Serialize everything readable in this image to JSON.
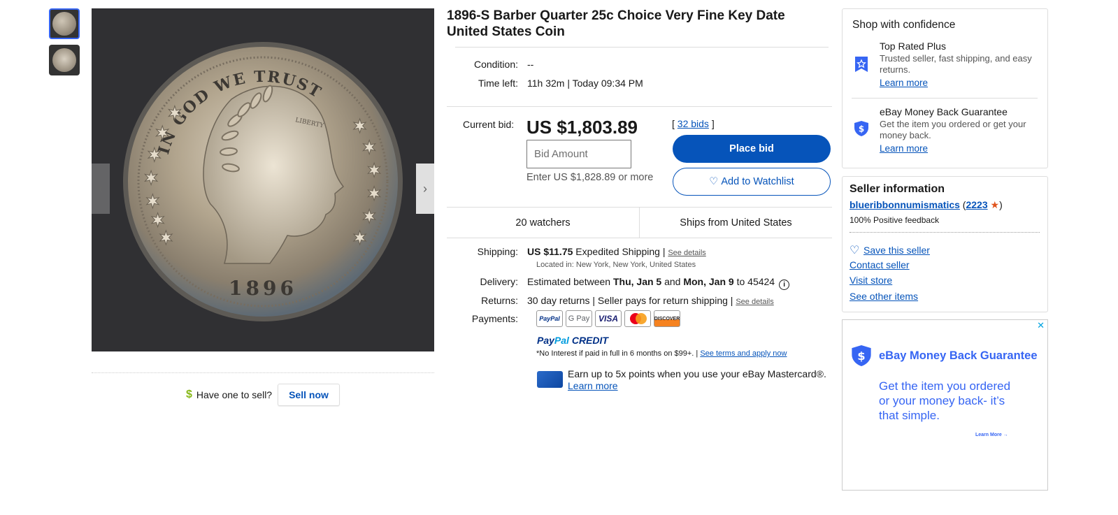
{
  "colors": {
    "brand_blue": "#0654ba",
    "accent_blue": "#3665f3",
    "text": "#191919",
    "muted": "#555555",
    "star": "#e0531c",
    "dollar_green": "#86b817"
  },
  "listing": {
    "title": "1896-S Barber Quarter 25c Choice Very Fine Key Date United States Coin",
    "condition_label": "Condition:",
    "condition_value": "--",
    "time_left_label": "Time left:",
    "time_left_value": "11h 32m | Today 09:34 PM",
    "current_bid_label": "Current bid:",
    "current_bid_value": "US $1,803.89",
    "bid_input_placeholder": "Bid Amount",
    "bid_hint": "Enter US $1,828.89 or more",
    "bids_open": "[ ",
    "bids_link": "32 bids",
    "bids_close": " ]",
    "place_bid": "Place bid",
    "watchlist": "Add to Watchlist",
    "watchers": "20 watchers",
    "ships_from": "Ships from United States"
  },
  "image": {
    "coin_inscription": "IN GOD WE TRUST",
    "coin_year": "1896",
    "coin_liberty": "LIBERTY"
  },
  "sell": {
    "prompt": "Have one to sell?",
    "button": "Sell now"
  },
  "shipping": {
    "label": "Shipping:",
    "price": "US $11.75",
    "method": " Expedited Shipping | ",
    "see_details": "See details",
    "location": "Located in: New York, New York, United States"
  },
  "delivery": {
    "label": "Delivery:",
    "text_a": "Estimated between ",
    "date_a": "Thu, Jan 5",
    "text_b": " and ",
    "date_b": "Mon, Jan 9",
    "text_c": " to 45424",
    "info_icon": "i"
  },
  "returns": {
    "label": "Returns:",
    "text": "30 day returns | Seller pays for return shipping | ",
    "see_details": "See details"
  },
  "payments": {
    "label": "Payments:",
    "methods": [
      "PayPal",
      "G Pay",
      "VISA",
      "Mastercard",
      "DISCOVER"
    ],
    "paypal_credit_a": "Pay",
    "paypal_credit_b": "Pal",
    "paypal_credit_c": " CREDIT",
    "note": "*No Interest if paid in full in 6 months on $99+. | ",
    "note_link": "See terms and apply now",
    "mastercard_text": "Earn up to 5x points when you use your eBay Mastercard®.",
    "mastercard_link": "Learn more"
  },
  "confidence": {
    "title": "Shop with confidence",
    "items": [
      {
        "heading": "Top Rated Plus",
        "text": "Trusted seller, fast shipping, and easy returns.",
        "link": "Learn more"
      },
      {
        "heading": "eBay Money Back Guarantee",
        "text": "Get the item you ordered or get your money back.",
        "link": "Learn more"
      }
    ]
  },
  "seller": {
    "title": "Seller information",
    "name": "blueribbonnumismatics",
    "feedback_open": " (",
    "feedback_score": "2223",
    "feedback_close": ")",
    "positive": "100% Positive feedback",
    "save": "Save this seller",
    "contact": "Contact seller",
    "visit": "Visit store",
    "other": "See other items"
  },
  "ad": {
    "close": "✕",
    "title": "eBay Money Back Guarantee",
    "body": "Get the item you ordered or your money back- it’s that simple.",
    "learn": "Learn More →"
  }
}
